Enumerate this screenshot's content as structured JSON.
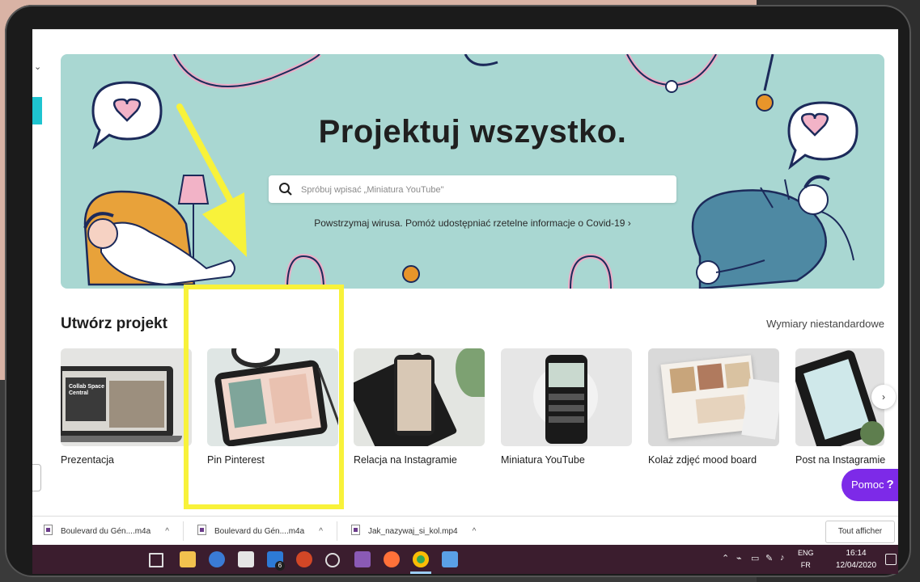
{
  "hero": {
    "title": "Projektuj wszystko.",
    "search_placeholder": "Spróbuj wpisać „Miniatura YouTube\"",
    "covid_link": "Powstrzymaj wirusa. Pomóż udostępniać rzetelne informacje o Covid-19 ›"
  },
  "section": {
    "title": "Utwórz projekt",
    "custom_size": "Wymiary niestandardowe"
  },
  "cards": [
    {
      "label": "Prezentacja"
    },
    {
      "label": "Pin Pinterest"
    },
    {
      "label": "Relacja na Instagramie"
    },
    {
      "label": "Miniatura YouTube"
    },
    {
      "label": "Kolaż zdjęć mood board"
    },
    {
      "label": "Post na Instagramie"
    }
  ],
  "thumb_text": {
    "presentation": "Collab Space Central"
  },
  "help": {
    "label": "Pomoc",
    "mark": "?"
  },
  "next_icon": "›",
  "downloads": {
    "items": [
      {
        "name": "Boulevard du Gén....m4a"
      },
      {
        "name": "Boulevard du Gén....m4a"
      },
      {
        "name": "Jak_nazywaj_si_kol.mp4"
      }
    ],
    "chevron": "^",
    "show_all": "Tout afficher"
  },
  "taskbar": {
    "badge": "6",
    "lang_top": "ENG",
    "lang_bottom": "FR",
    "time": "16:14",
    "date": "12/04/2020"
  },
  "colors": {
    "hero_bg": "#a9d7d2",
    "help_purple": "#7d2ae8",
    "highlight_yellow": "#f8f23a",
    "taskbar": "#3b1d2e"
  },
  "icons": [
    "search-icon",
    "chevron-right-icon",
    "file-icon",
    "task-view-icon",
    "file-explorer-icon",
    "store-icon",
    "mail-icon",
    "powerpoint-icon",
    "firefox-icon",
    "chrome-icon",
    "photos-icon",
    "notification-icon"
  ]
}
